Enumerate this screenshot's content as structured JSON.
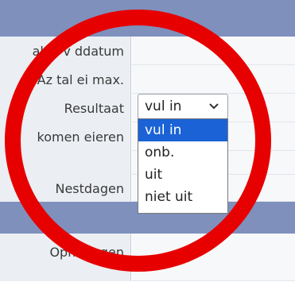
{
  "fields": [
    {
      "label": "al ei v  ddatum"
    },
    {
      "label": "Az  tal ei max."
    },
    {
      "label": "Resultaat"
    },
    {
      "label": "  komen eieren"
    },
    {
      "label": ""
    },
    {
      "label": "Nestdagen"
    }
  ],
  "remarks": {
    "label": "Opme    ngen"
  },
  "resultaat_select": {
    "value": "vul in",
    "options": [
      "vul in",
      "onb.",
      "uit",
      "niet uit"
    ]
  },
  "annotation": {
    "color": "#e60000",
    "shape": "circle"
  }
}
